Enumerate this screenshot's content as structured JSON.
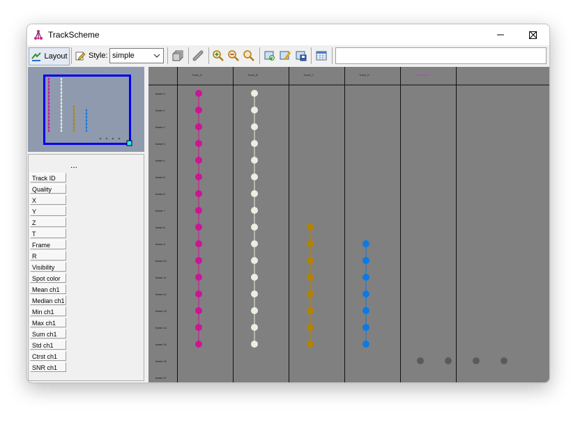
{
  "window": {
    "title": "TrackScheme"
  },
  "toolbar": {
    "layout_label": "Layout",
    "style_label": "Style:",
    "style_value": "simple",
    "search_value": ""
  },
  "outline": {
    "tracks": [
      {
        "color": "#cc1593",
        "from": 0,
        "to": 15
      },
      {
        "color": "#e8f0e0",
        "from": 0,
        "to": 15
      },
      {
        "color": "#b38300",
        "from": 8,
        "to": 15
      },
      {
        "color": "#0a7ae8",
        "from": 9,
        "to": 15
      }
    ],
    "lonely_count": 4,
    "lonely_color": "#5a5a5a"
  },
  "properties": {
    "ellipsis": "...",
    "items": [
      "Track ID",
      "Quality",
      "X",
      "Y",
      "Z",
      "T",
      "Frame",
      "R",
      "Visibility",
      "Spot color",
      "Mean ch1",
      "Median ch1",
      "Min ch1",
      "Max ch1",
      "Sum ch1",
      "Std ch1",
      "Ctrst ch1",
      "SNR ch1"
    ]
  },
  "scheme": {
    "columns": [
      {
        "header": "Track_A",
        "color": "#cc1593",
        "first_frame": 0,
        "last_frame": 15
      },
      {
        "header": "Track_B",
        "color": "#e8f0e0",
        "first_frame": 0,
        "last_frame": 15
      },
      {
        "header": "Track_C",
        "color": "#b38300",
        "first_frame": 8,
        "last_frame": 15
      },
      {
        "header": "Track_D",
        "color": "#0a7ae8",
        "first_frame": 9,
        "last_frame": 15
      },
      {
        "header": "Unlaid spots",
        "color": "#d22ad2",
        "lonely": true,
        "lonely_frame": 16,
        "lonely_count": 4,
        "lonely_color": "#5a5a5a"
      }
    ],
    "frames": [
      "frame 0",
      "frame 1",
      "frame 2",
      "frame 3",
      "frame 4",
      "frame 5",
      "frame 6",
      "frame 7",
      "frame 8",
      "frame 9",
      "frame 10",
      "frame 11",
      "frame 12",
      "frame 13",
      "frame 14",
      "frame 15",
      "frame 16",
      "frame 17"
    ]
  }
}
